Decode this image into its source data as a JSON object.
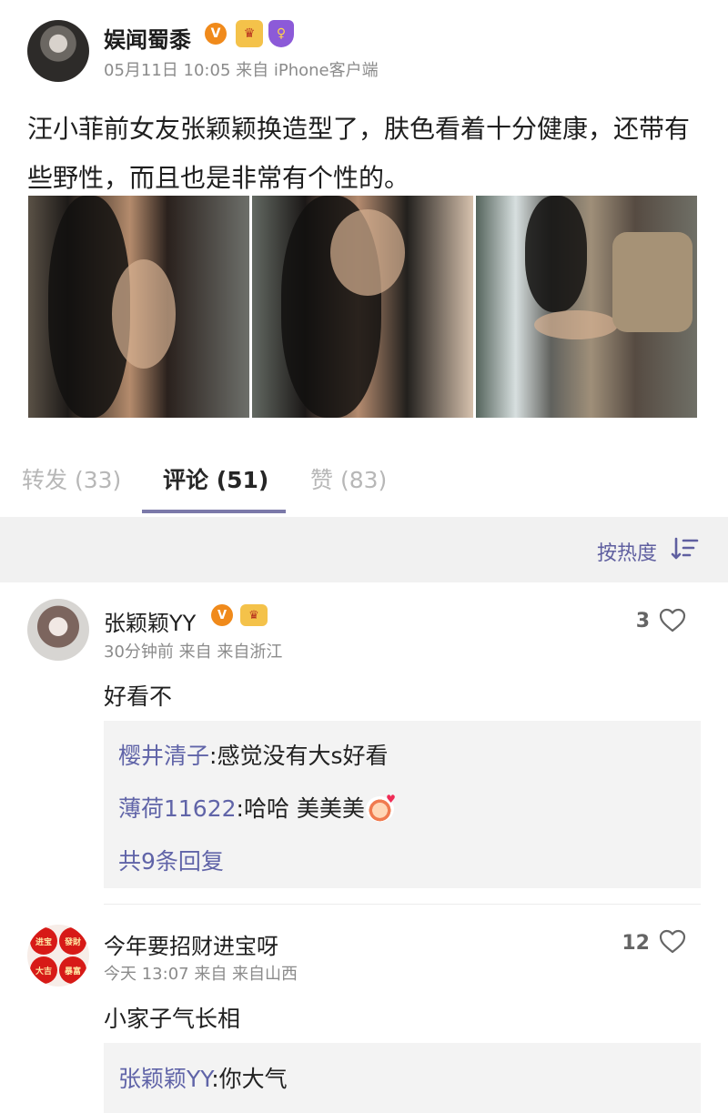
{
  "post": {
    "author": "娱闻蜀黍",
    "meta": "05月11日 10:05  来自 iPhone客户端",
    "text": "汪小菲前女友张颖颖换造型了，肤色看着十分健康，还带有些野性，而且也是非常有个性的。"
  },
  "tabs": {
    "repost": "转发 (33)",
    "comments": "评论 (51)",
    "likes": "赞 (83)"
  },
  "sort": {
    "label": "按热度"
  },
  "comments": [
    {
      "name": "张颖颖YY",
      "meta": "30分钟前 来自 来自浙江",
      "text": "好看不",
      "likes": "3",
      "replies": [
        {
          "name": "樱井清子",
          "text": ":感觉没有大s好看"
        },
        {
          "name": "薄荷11622",
          "text": ":哈哈 美美美"
        }
      ],
      "more": "共9条回复"
    },
    {
      "name": "今年要招财进宝呀",
      "meta": "今天 13:07 来自 来自山西",
      "text": "小家子气长相",
      "likes": "12",
      "replies": [
        {
          "name": "张颖颖YY",
          "text": ":你大气"
        }
      ],
      "avatar_labels": [
        "进宝",
        "發財",
        "大吉",
        "暴富"
      ]
    }
  ],
  "colors": {
    "accent": "#7b79a9",
    "link": "#6064a8",
    "vip": "#f08a1b"
  },
  "icons": {
    "verified": "verified-icon",
    "crown": "crown-badge-icon",
    "shield": "shield-badge-icon",
    "sort": "sort-icon",
    "heart": "heart-outline-icon",
    "emoji": "emoji-icon"
  }
}
